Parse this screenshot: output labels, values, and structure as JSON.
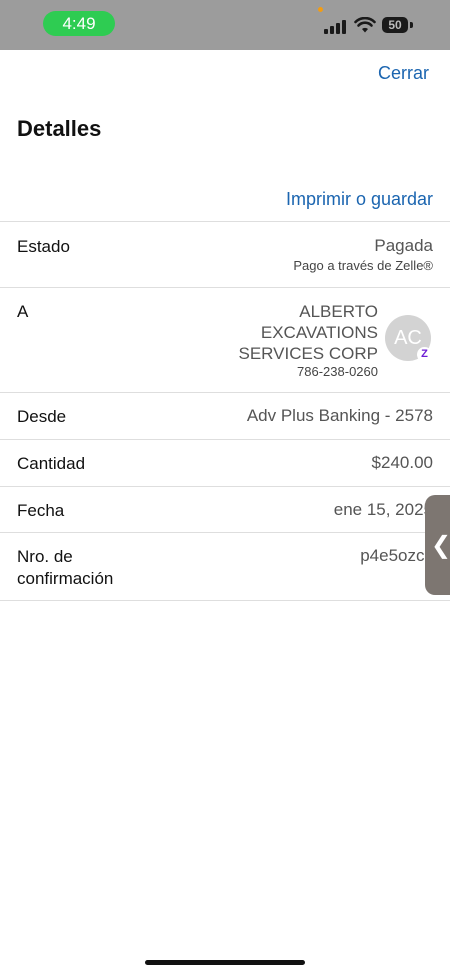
{
  "status_bar": {
    "time": "4:49",
    "battery": "50"
  },
  "header": {
    "close_label": "Cerrar",
    "title": "Detalles"
  },
  "print_label": "Imprimir o guardar",
  "details": {
    "estado": {
      "label": "Estado",
      "value": "Pagada",
      "sub": "Pago a través de Zelle®"
    },
    "a": {
      "label": "A",
      "name": "ALBERTO EXCAVATIONS SERVICES CORP",
      "phone": "786-238-0260",
      "initials": "AC",
      "badge": "Z"
    },
    "desde": {
      "label": "Desde",
      "value": "Adv Plus Banking - 2578"
    },
    "cantidad": {
      "label": "Cantidad",
      "value": "$240.00"
    },
    "fecha": {
      "label": "Fecha",
      "value": "ene 15, 2025"
    },
    "confirmacion": {
      "label": "Nro. de confirmación",
      "value": "p4e5ozcs"
    }
  },
  "side_tab_glyph": "❮"
}
